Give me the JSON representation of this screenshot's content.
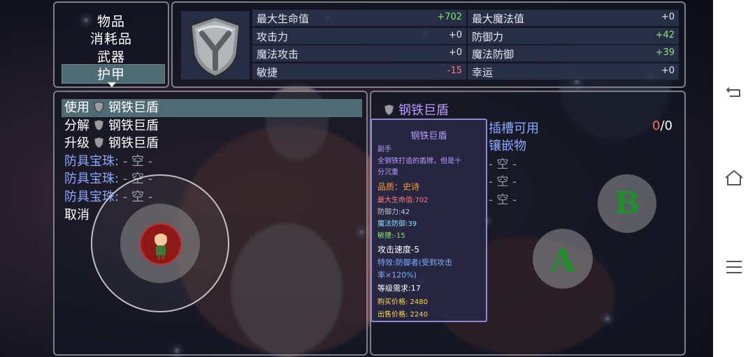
{
  "category_menu": {
    "items": [
      "物品",
      "消耗品",
      "武器",
      "护甲"
    ],
    "selected_index": 3
  },
  "stats": {
    "left": [
      {
        "label": "最大生命值",
        "value": "+702",
        "color": "#8ee07a"
      },
      {
        "label": "攻击力",
        "value": "+0",
        "color": "#e8e8e8"
      },
      {
        "label": "魔法攻击",
        "value": "+0",
        "color": "#e8e8e8"
      },
      {
        "label": "敏捷",
        "value": "-15",
        "color": "#ff7b7b"
      }
    ],
    "right": [
      {
        "label": "最大魔法值",
        "value": "+0",
        "color": "#e8e8e8"
      },
      {
        "label": "防御力",
        "value": "+42",
        "color": "#8ee07a"
      },
      {
        "label": "魔法防御",
        "value": "+39",
        "color": "#8ee07a"
      },
      {
        "label": "幸运",
        "value": "+0",
        "color": "#e8e8e8"
      }
    ]
  },
  "actions": {
    "use": "使用",
    "disassemble": "分解",
    "upgrade": "升级",
    "item_name": "钢铁巨盾",
    "gem_label": "防具宝珠:",
    "gem_empty": "- 空 -",
    "cancel": "取消"
  },
  "detail": {
    "title": "钢铁巨盾",
    "socket_title": "插槽可用",
    "socket_count_used": "0",
    "socket_count_sep": "/",
    "socket_count_total": "0",
    "inlay_title": "镶嵌物",
    "inlay_empty": [
      "- 空 -",
      "- 空 -",
      "- 空 -"
    ]
  },
  "tooltip": {
    "name": "钢铁巨盾",
    "slot": "副手",
    "desc1": "全钢铁打造的盾牌，但是十",
    "desc2": "分沉重",
    "quality": "品质：史诗",
    "hp": "最大生命值:702",
    "def": "防御力:42",
    "mdef": "魔法防御:39",
    "agi": "敏捷:-15",
    "atk_speed": "攻击速度-5",
    "effect1": "特效:防御者(受到攻击",
    "effect2": "率×120%)",
    "level_req": "等级需求:17",
    "buy_price": "购买价格: 2480",
    "sell_price": "出售价格: 2240"
  },
  "controls": {
    "a_label": "A",
    "b_label": "B"
  },
  "colors": {
    "accent_blue": "#8aa8ff",
    "purple_title": "#b99cff",
    "quality_orange": "#ff9d3a",
    "socket_red": "#ff6a6a"
  }
}
